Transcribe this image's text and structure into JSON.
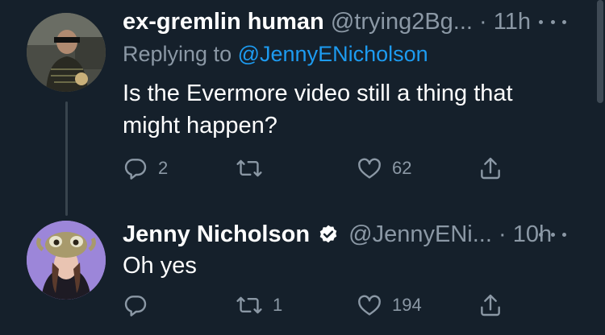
{
  "tweets": [
    {
      "name": "ex-gremlin human",
      "handle": "@trying2Bg...",
      "dot": "·",
      "time": "11h",
      "replying_prefix": "Replying to",
      "replying_to": "@JennyENicholson",
      "text_line1": "Is the Evermore video still a thing that",
      "text_line2": "might happen?",
      "replies": "2",
      "retweets": "",
      "likes": "62"
    },
    {
      "name": "Jenny Nicholson",
      "handle": "@JennyENi...",
      "dot": "·",
      "time": "10h",
      "verified": true,
      "text_line1": "Oh yes",
      "replies": "",
      "retweets": "1",
      "likes": "194"
    }
  ],
  "icons": {
    "reply": "reply-icon",
    "retweet": "retweet-icon",
    "like": "heart-icon",
    "share": "share-icon",
    "more": "more-icon",
    "verified": "verified-badge-icon"
  },
  "colors": {
    "background": "#15202b",
    "secondary_text": "#8b98a5",
    "link": "#1d9bf0",
    "thread_line": "#38444d"
  }
}
